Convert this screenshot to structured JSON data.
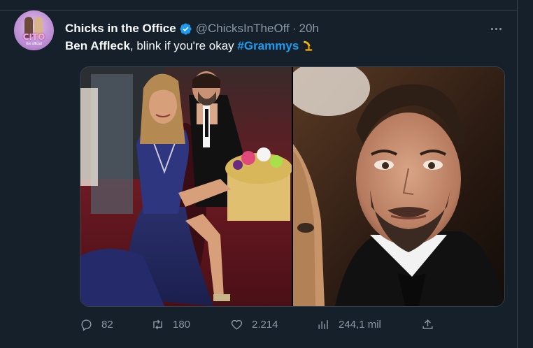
{
  "tweet": {
    "author_name": "Chicks in the Office",
    "handle": "@ChicksInTheOff",
    "separator": "·",
    "time": "20h",
    "text_bold": "Ben Affleck",
    "text_rest": ", blink if you're okay ",
    "hashtag": "#Grammys",
    "avatar_text": "CITO",
    "avatar_subtext": "the official",
    "emoji": "gramophone-emoji"
  },
  "actions": {
    "replies": "82",
    "retweets": "180",
    "likes": "2.214",
    "views": "244,1 mil"
  },
  "icons": {
    "verified": "verified-badge-icon",
    "more": "more-dots-icon",
    "reply": "reply-icon",
    "retweet": "retweet-icon",
    "like": "heart-icon",
    "views": "views-icon",
    "share": "share-icon"
  },
  "colors": {
    "background": "#15202b",
    "accent": "#1d9bf0",
    "muted": "#8b98a5",
    "border": "#38444d"
  }
}
